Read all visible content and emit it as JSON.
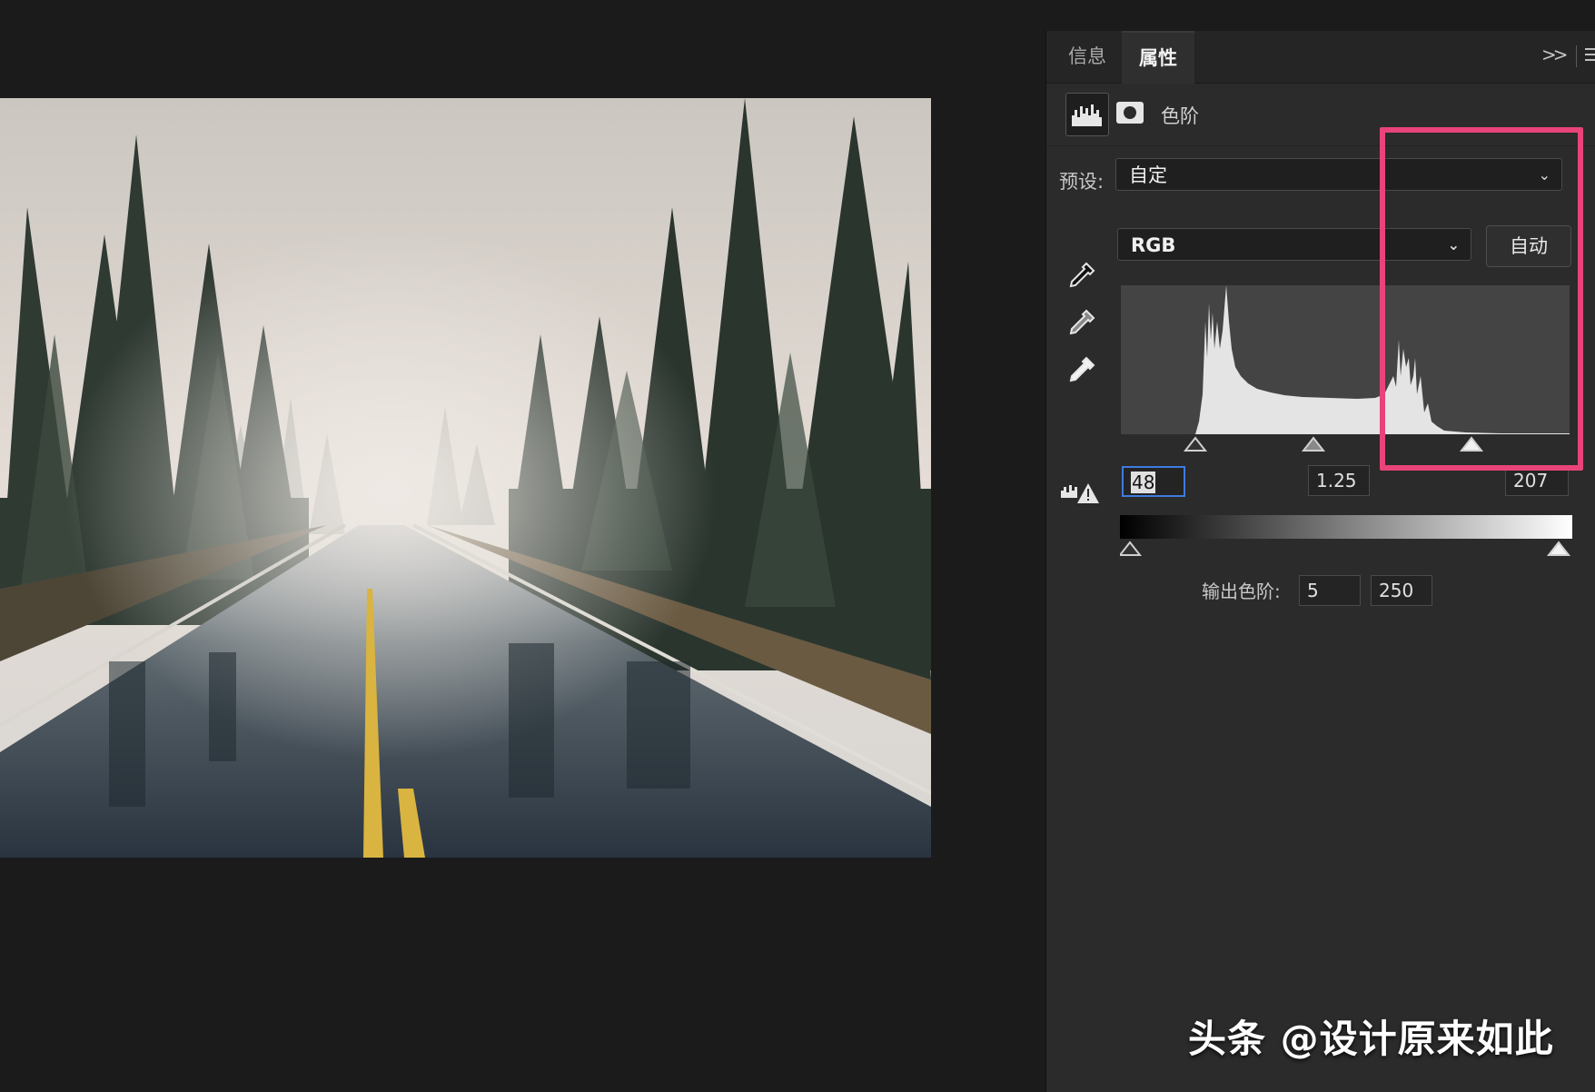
{
  "tabs": [
    {
      "label": "信息",
      "active": false
    },
    {
      "label": "属性",
      "active": true
    }
  ],
  "panel_icons": [
    "collapse-chevrons-icon",
    "panel-menu-icon"
  ],
  "adjustment": {
    "title": "色阶",
    "icons": [
      "levels-histogram-icon",
      "layer-mask-icon"
    ]
  },
  "preset": {
    "label": "预设:",
    "value": "自定"
  },
  "channel": {
    "value": "RGB"
  },
  "auto_button": "自动",
  "eyedroppers": [
    "black-point-eyedropper-icon",
    "gray-point-eyedropper-icon",
    "white-point-eyedropper-icon"
  ],
  "input_levels": {
    "black": "48",
    "mid": "1.25",
    "white": "207"
  },
  "output_levels": {
    "label": "输出色阶:",
    "low": "5",
    "high": "250"
  },
  "highlight_color": "#e8447a",
  "watermark": "头条 @设计原来如此"
}
